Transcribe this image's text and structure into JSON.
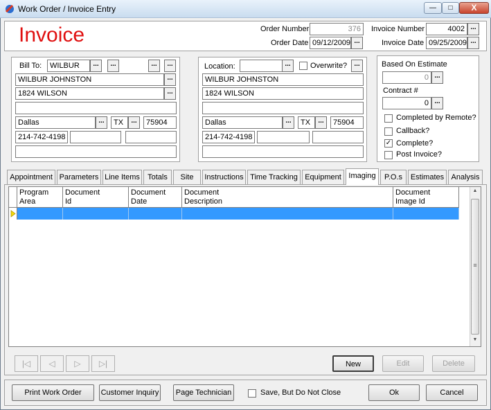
{
  "window": {
    "title": "Work Order / Invoice Entry",
    "minimize": "—",
    "maximize": "□",
    "close": "X"
  },
  "header": {
    "heading": "Invoice",
    "order_number_label": "Order Number",
    "order_number": "376",
    "order_date_label": "Order Date",
    "order_date": "09/12/2009",
    "invoice_number_label": "Invoice Number",
    "invoice_number": "4002",
    "invoice_date_label": "Invoice Date",
    "invoice_date": "09/25/2009"
  },
  "dots": "...",
  "bill_to": {
    "label": "Bill To:",
    "code": "WILBUR",
    "name": "WILBUR JOHNSTON",
    "address1": "1824 WILSON",
    "address2": "",
    "city": "Dallas",
    "state": "TX",
    "zip": "75904",
    "phone": "214-742-4198"
  },
  "location": {
    "label": "Location:",
    "code": "",
    "overwrite_label": "Overwrite?",
    "name": "WILBUR JOHNSTON",
    "address1": "1824 WILSON",
    "address2": "",
    "city": "Dallas",
    "state": "TX",
    "zip": "75904",
    "phone": "214-742-4198"
  },
  "options": {
    "based_on_estimate_label": "Based On Estimate",
    "based_on_estimate": "0",
    "contract_label": "Contract #",
    "contract": "0",
    "completed_by_remote": "Completed by Remote?",
    "callback": "Callback?",
    "complete": "Complete?",
    "complete_checked": "✓",
    "post_invoice": "Post Invoice?"
  },
  "tabs": [
    "Appointment",
    "Parameters",
    "Line Items",
    "Totals",
    "Site",
    "Instructions",
    "Time Tracking",
    "Equipment",
    "Imaging",
    "P.O.s",
    "Estimates",
    "Analysis"
  ],
  "grid": {
    "columns": [
      {
        "line1": "Program",
        "line2": "Area"
      },
      {
        "line1": "Document",
        "line2": "Id"
      },
      {
        "line1": "Document",
        "line2": "Date"
      },
      {
        "line1": "Document",
        "line2": "Description"
      },
      {
        "line1": "Document",
        "line2": "Image Id"
      }
    ]
  },
  "nav": {
    "first": "|◁",
    "prev": "◁",
    "next": "▷",
    "last": "▷|"
  },
  "buttons": {
    "new": "New",
    "edit": "Edit",
    "delete": "Delete",
    "print_work_order": "Print Work Order",
    "customer_inquiry": "Customer Inquiry",
    "page_technician": "Page Technician",
    "save_not_close": "Save, But Do Not Close",
    "ok": "Ok",
    "cancel": "Cancel"
  },
  "scroll": {
    "up": "▲",
    "down": "▼",
    "grip": "≡"
  }
}
